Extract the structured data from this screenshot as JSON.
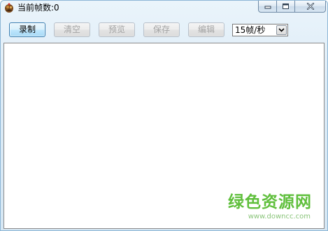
{
  "window": {
    "title": "当前帧数:0"
  },
  "toolbar": {
    "record_label": "录制",
    "clear_label": "清空",
    "preview_label": "预览",
    "save_label": "保存",
    "edit_label": "编辑",
    "fps_selected": "15帧/秒"
  },
  "watermark": {
    "title": "绿色资源网",
    "url": "www.downcc.com"
  },
  "icons": {
    "app": "app-icon",
    "minimize": "minimize-icon",
    "maximize": "maximize-icon",
    "close": "close-icon",
    "dropdown": "chevron-down-icon"
  },
  "colors": {
    "frame_border": "#8cb6d6",
    "active_button_border": "#3c7fb1",
    "disabled_text": "#a3a3a3",
    "watermark_green": "#5fbf3c"
  }
}
